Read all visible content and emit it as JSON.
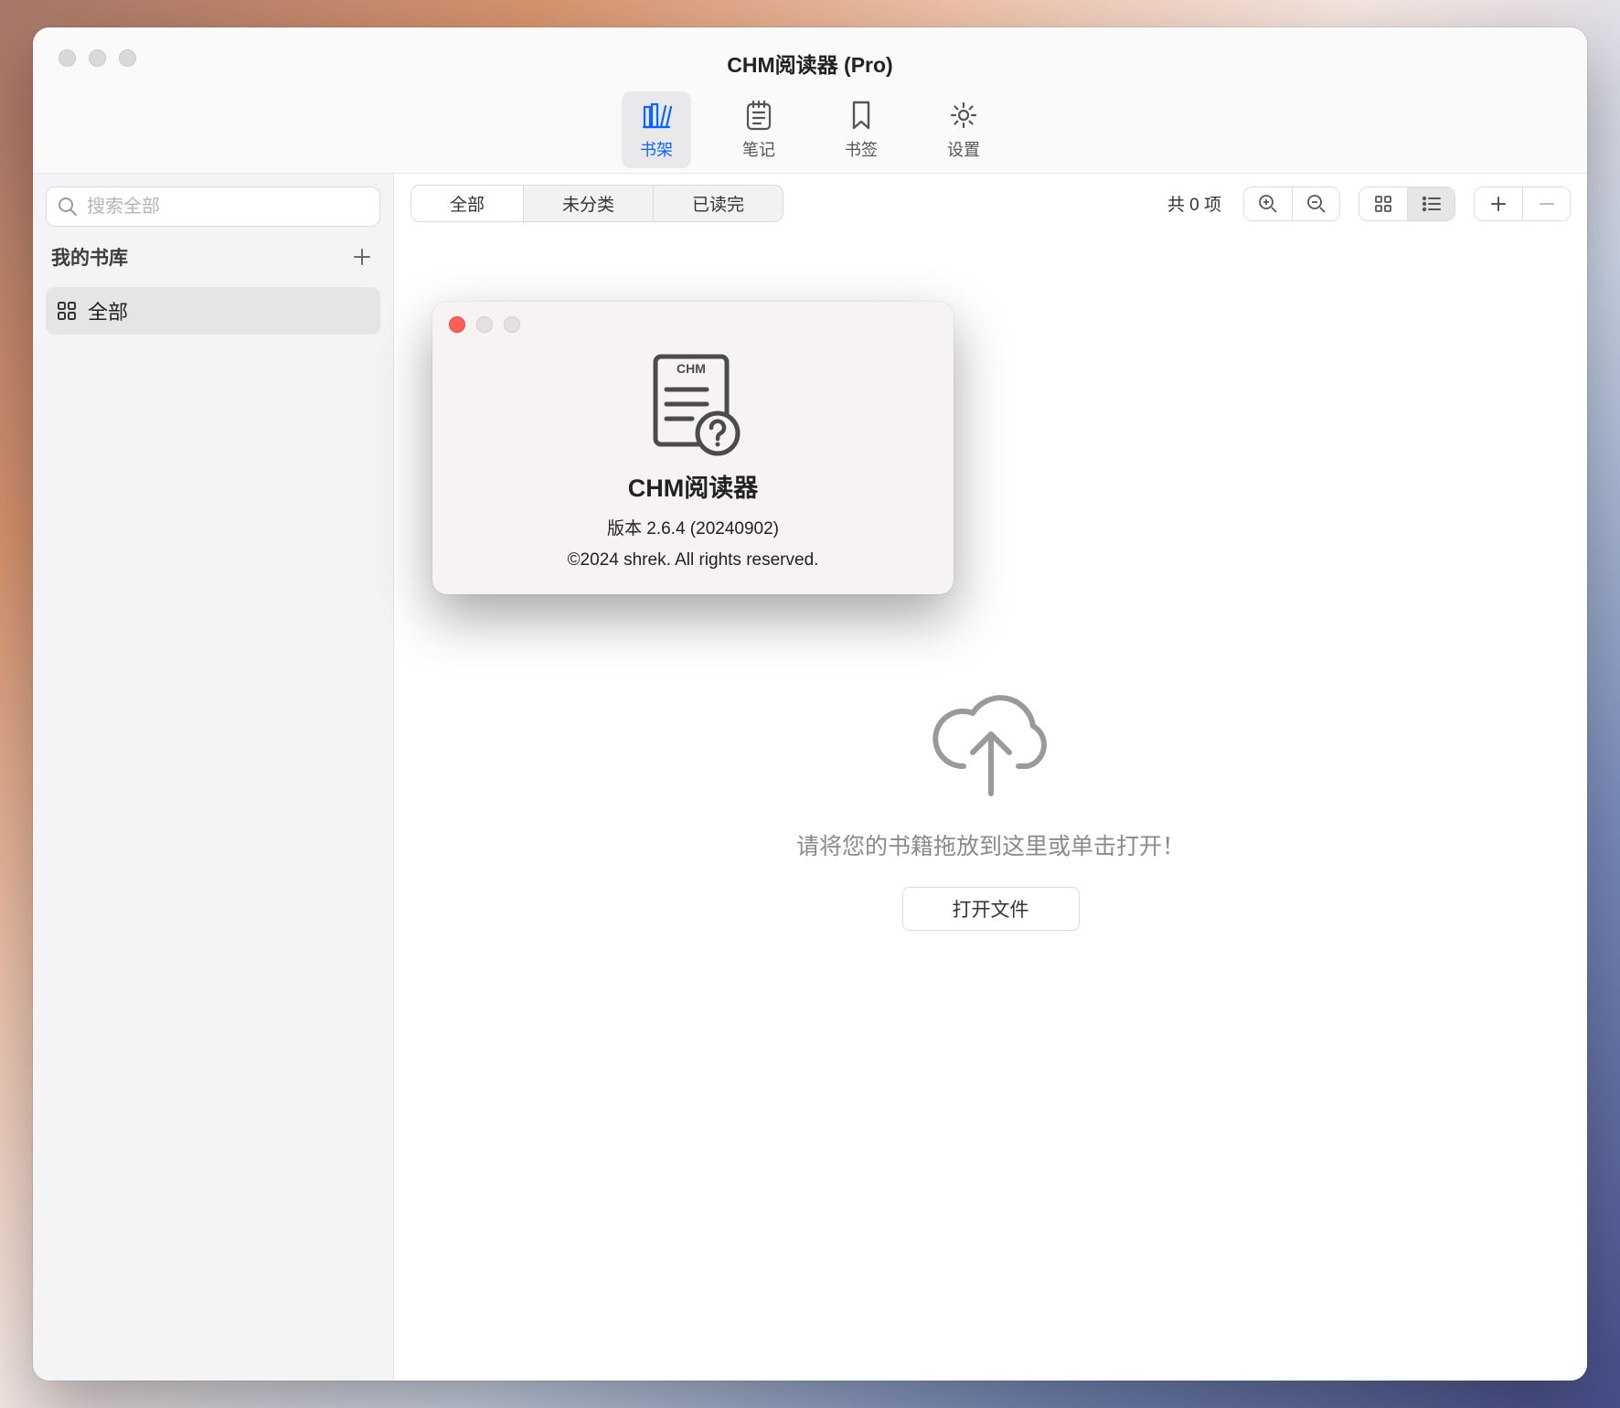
{
  "window": {
    "title": "CHM阅读器 (Pro)"
  },
  "toolbar": {
    "bookshelf": "书架",
    "notes": "笔记",
    "bookmarks": "书签",
    "settings": "设置"
  },
  "sidebar": {
    "search_placeholder": "搜索全部",
    "library_header": "我的书库",
    "items": [
      {
        "label": "全部"
      }
    ]
  },
  "filter": {
    "tabs": {
      "all": "全部",
      "uncategorized": "未分类",
      "read": "已读完"
    },
    "count_label": "共 0 项"
  },
  "empty": {
    "message": "请将您的书籍拖放到这里或单击打开！",
    "open_button": "打开文件"
  },
  "about": {
    "app_name": "CHM阅读器",
    "version": "版本 2.6.4 (20240902)",
    "copyright": "©2024 shrek. All rights reserved.",
    "icon_badge": "CHM"
  }
}
